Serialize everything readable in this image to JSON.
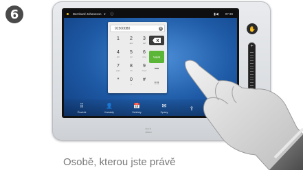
{
  "step": {
    "number": "6"
  },
  "status_bar": {
    "user": "Bernhard Johansson",
    "caret": "▼",
    "info_icon": "info-icon",
    "camera_icon": "camera-icon",
    "time": "07:39"
  },
  "dialer": {
    "number_value": "91500080",
    "clear_icon": "clear-icon",
    "keys": [
      {
        "digit": "1",
        "letters": ""
      },
      {
        "digit": "2",
        "letters": "abc"
      },
      {
        "digit": "3",
        "letters": "def"
      },
      {
        "digit": "4",
        "letters": "ghi"
      },
      {
        "digit": "5",
        "letters": "jkl"
      },
      {
        "digit": "6",
        "letters": "mno"
      },
      {
        "digit": "7",
        "letters": "pqrs"
      },
      {
        "digit": "8",
        "letters": "tuv"
      },
      {
        "digit": "9",
        "letters": "wxyz"
      },
      {
        "digit": "*",
        "letters": ""
      },
      {
        "digit": "0",
        "letters": "+"
      },
      {
        "digit": "#",
        "letters": ""
      }
    ],
    "backspace_icon": "backspace-icon",
    "call_label": "Volat",
    "more_label": "•••",
    "dtmf_label": "⠿⠿"
  },
  "taskbar": {
    "items": [
      {
        "label": "Číselník",
        "icon": "dialpad-icon",
        "glyph": "⠿"
      },
      {
        "label": "Kontakty",
        "icon": "contacts-icon",
        "glyph": "👤"
      },
      {
        "label": "Schůzky",
        "icon": "calendar-icon",
        "glyph": "📅"
      },
      {
        "label": "Zprávy",
        "icon": "voicemail-icon",
        "glyph": "✉"
      },
      {
        "label": "",
        "icon": "share-icon",
        "glyph": "⇪"
      }
    ]
  },
  "right_strip": {
    "touch_icon": "hand-icon",
    "volume_plus": "+",
    "volume_minus": "−"
  },
  "brand": {
    "logo_text": "cisco"
  },
  "caption": {
    "text": "Osobě, kterou jste právě"
  },
  "colors": {
    "call_green": "#5bb536",
    "screen_blue": "#1e5aa6"
  }
}
